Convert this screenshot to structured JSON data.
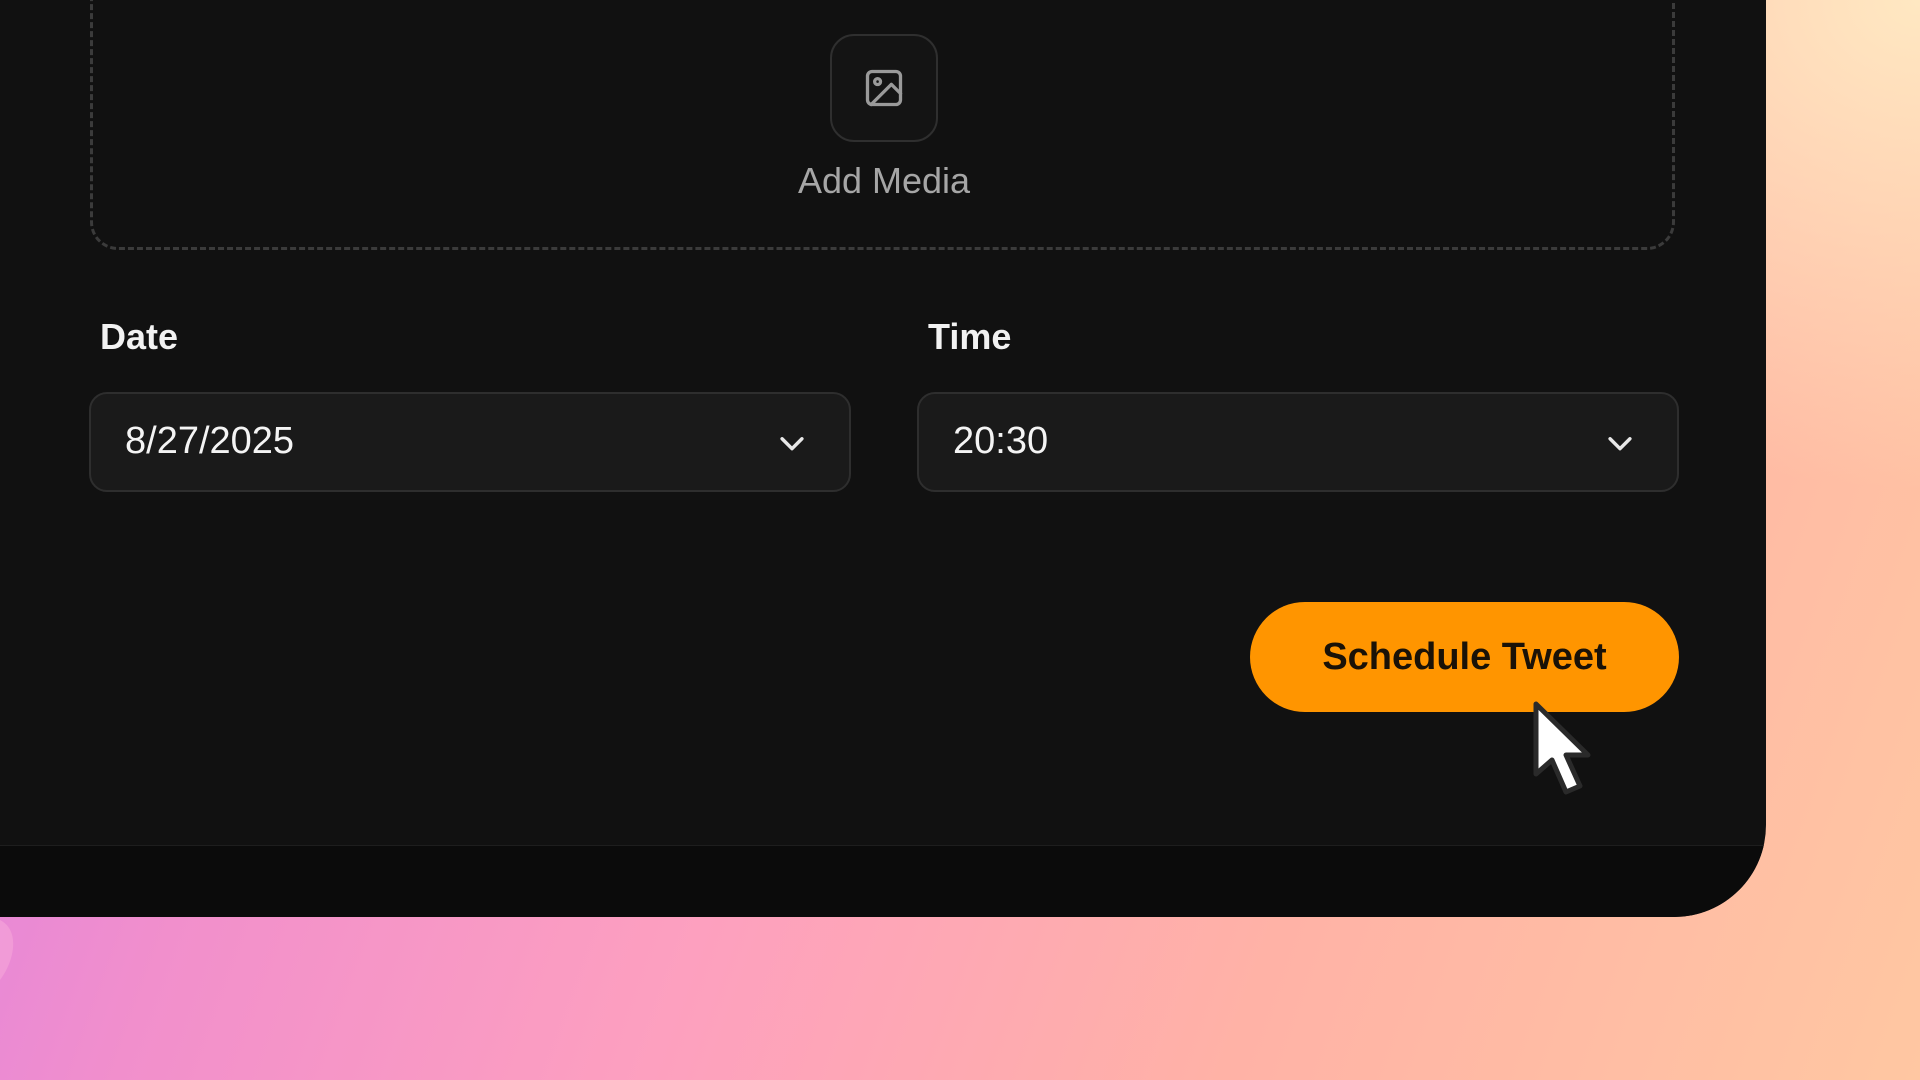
{
  "media": {
    "icon": "image-icon",
    "label": "Add Media"
  },
  "schedule": {
    "date_label": "Date",
    "date_value": "8/27/2025",
    "time_label": "Time",
    "time_value": "20:30",
    "submit_label": "Schedule Tweet"
  },
  "colors": {
    "panel_background": "#111111",
    "accent": "#ff9500",
    "input_background": "#1a1a1a",
    "muted_text": "#a6a6a6"
  }
}
